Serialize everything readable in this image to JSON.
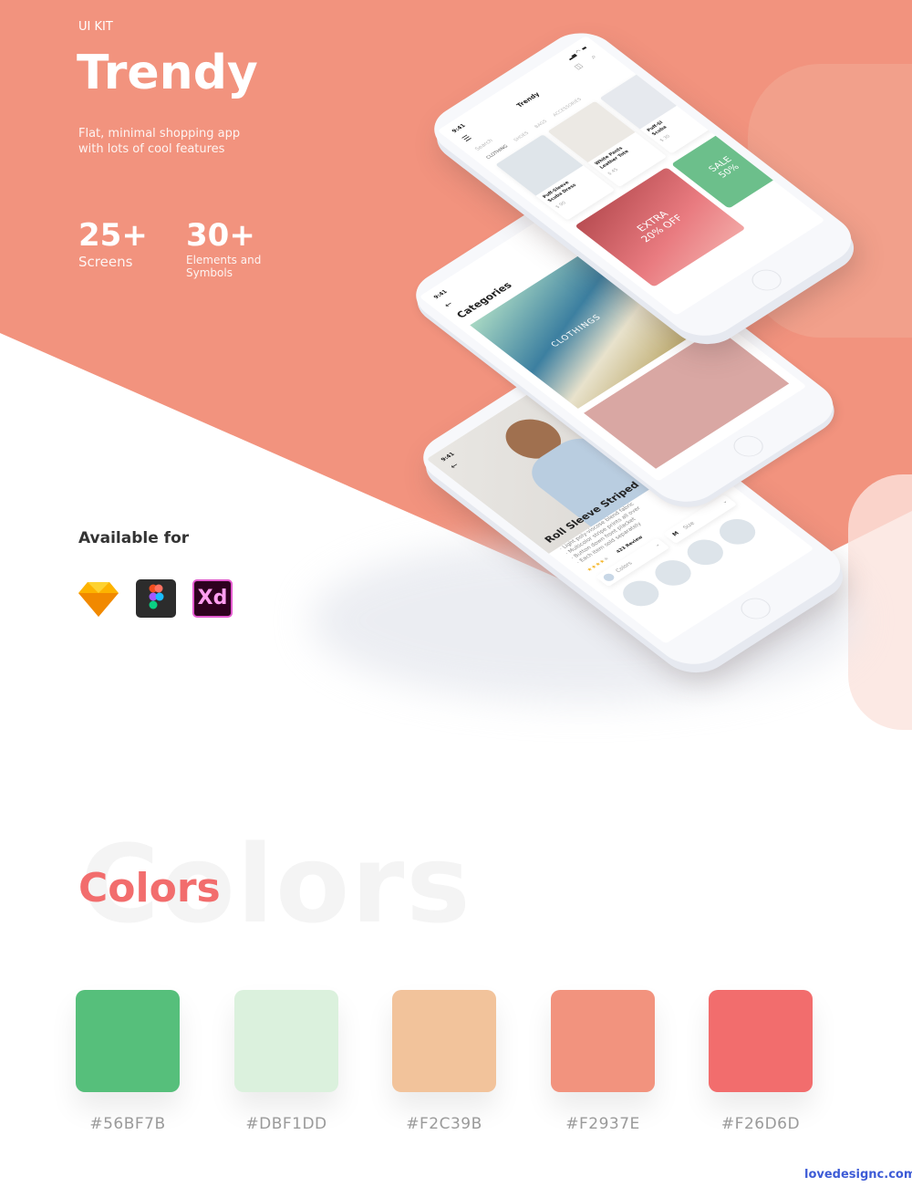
{
  "hero": {
    "kicker": "UI KIT",
    "title": "Trendy",
    "subtitle_line1": "Flat, minimal shopping app",
    "subtitle_line2": "with lots of cool features",
    "stats": [
      {
        "value": "25+",
        "label_line1": "Screens",
        "label_line2": ""
      },
      {
        "value": "30+",
        "label_line1": "Elements and",
        "label_line2": "Symbols"
      }
    ]
  },
  "available": {
    "heading": "Available for",
    "tools": [
      {
        "name": "sketch-icon"
      },
      {
        "name": "figma-icon"
      },
      {
        "name": "xd-icon",
        "label": "Xd"
      }
    ]
  },
  "phone_home": {
    "time": "9:41",
    "title": "Trendy",
    "search_placeholder": "Search",
    "tabs": [
      "CLOTHING",
      "SHOES",
      "BAGS",
      "ACCESSORIES"
    ],
    "products": [
      {
        "name_line1": "Puff-Sleeve",
        "name_line2": "Scuba Dress",
        "price": "$ 90"
      },
      {
        "name_line1": "White Pants",
        "name_line2": "Leather Tote",
        "price": "$ 45"
      },
      {
        "name_line1": "Puff-Sl",
        "name_line2": "Scuba",
        "price": "$ 30"
      }
    ],
    "promos": [
      {
        "line1": "EXTRA",
        "line2": "20% OFF"
      },
      {
        "line1": "SALE",
        "line2": "50%"
      }
    ]
  },
  "phone_categories": {
    "time": "9:41",
    "title": "Categories",
    "category": "CLOTHINGS"
  },
  "phone_product": {
    "time": "9:41",
    "title": "Roll Sleeve Striped Shirt",
    "bullets": [
      "· Light poly-viscose blend fabric",
      "· Multicolor stripe prints all over",
      "· Button down front placket",
      "· Each item sold separately"
    ],
    "rating": 4,
    "reviews": "423 Review",
    "colors_label": "Colors",
    "size_value": "M",
    "size_label": "Size"
  },
  "colors": {
    "heading": "Colors",
    "ghost": "Colors",
    "swatches": [
      {
        "hex": "#56BF7B",
        "label": "#56BF7B"
      },
      {
        "hex": "#DBF1DD",
        "label": "#DBF1DD"
      },
      {
        "hex": "#F2C39B",
        "label": "#F2C39B"
      },
      {
        "hex": "#F2937E",
        "label": "#F2937E"
      },
      {
        "hex": "#F26D6D",
        "label": "#F26D6D"
      }
    ]
  },
  "watermark": "lovedesignc.com",
  "theme": {
    "coral": "#F2937E",
    "red": "#F26D6D"
  }
}
